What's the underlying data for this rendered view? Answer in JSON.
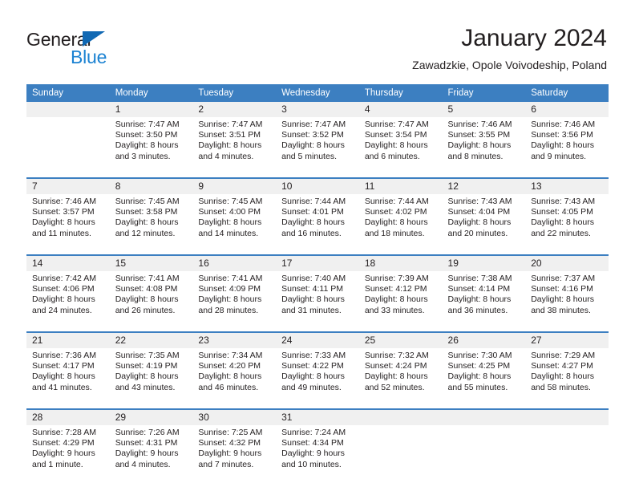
{
  "brand": {
    "name_part1": "General",
    "name_part2": "Blue",
    "triangle_color": "#1068b3",
    "blue_color": "#1b82d2"
  },
  "header": {
    "title": "January 2024",
    "subtitle": "Zawadzkie, Opole Voivodeship, Poland"
  },
  "theme": {
    "header_blue": "#3c7fc1",
    "daynum_bg": "#f0f0f0",
    "text_color": "#231f20"
  },
  "calendar": {
    "weekday_headers": [
      "Sunday",
      "Monday",
      "Tuesday",
      "Wednesday",
      "Thursday",
      "Friday",
      "Saturday"
    ],
    "weeks": [
      [
        {
          "day": "",
          "lines": []
        },
        {
          "day": "1",
          "lines": [
            "Sunrise: 7:47 AM",
            "Sunset: 3:50 PM",
            "Daylight: 8 hours",
            "and 3 minutes."
          ]
        },
        {
          "day": "2",
          "lines": [
            "Sunrise: 7:47 AM",
            "Sunset: 3:51 PM",
            "Daylight: 8 hours",
            "and 4 minutes."
          ]
        },
        {
          "day": "3",
          "lines": [
            "Sunrise: 7:47 AM",
            "Sunset: 3:52 PM",
            "Daylight: 8 hours",
            "and 5 minutes."
          ]
        },
        {
          "day": "4",
          "lines": [
            "Sunrise: 7:47 AM",
            "Sunset: 3:54 PM",
            "Daylight: 8 hours",
            "and 6 minutes."
          ]
        },
        {
          "day": "5",
          "lines": [
            "Sunrise: 7:46 AM",
            "Sunset: 3:55 PM",
            "Daylight: 8 hours",
            "and 8 minutes."
          ]
        },
        {
          "day": "6",
          "lines": [
            "Sunrise: 7:46 AM",
            "Sunset: 3:56 PM",
            "Daylight: 8 hours",
            "and 9 minutes."
          ]
        }
      ],
      [
        {
          "day": "7",
          "lines": [
            "Sunrise: 7:46 AM",
            "Sunset: 3:57 PM",
            "Daylight: 8 hours",
            "and 11 minutes."
          ]
        },
        {
          "day": "8",
          "lines": [
            "Sunrise: 7:45 AM",
            "Sunset: 3:58 PM",
            "Daylight: 8 hours",
            "and 12 minutes."
          ]
        },
        {
          "day": "9",
          "lines": [
            "Sunrise: 7:45 AM",
            "Sunset: 4:00 PM",
            "Daylight: 8 hours",
            "and 14 minutes."
          ]
        },
        {
          "day": "10",
          "lines": [
            "Sunrise: 7:44 AM",
            "Sunset: 4:01 PM",
            "Daylight: 8 hours",
            "and 16 minutes."
          ]
        },
        {
          "day": "11",
          "lines": [
            "Sunrise: 7:44 AM",
            "Sunset: 4:02 PM",
            "Daylight: 8 hours",
            "and 18 minutes."
          ]
        },
        {
          "day": "12",
          "lines": [
            "Sunrise: 7:43 AM",
            "Sunset: 4:04 PM",
            "Daylight: 8 hours",
            "and 20 minutes."
          ]
        },
        {
          "day": "13",
          "lines": [
            "Sunrise: 7:43 AM",
            "Sunset: 4:05 PM",
            "Daylight: 8 hours",
            "and 22 minutes."
          ]
        }
      ],
      [
        {
          "day": "14",
          "lines": [
            "Sunrise: 7:42 AM",
            "Sunset: 4:06 PM",
            "Daylight: 8 hours",
            "and 24 minutes."
          ]
        },
        {
          "day": "15",
          "lines": [
            "Sunrise: 7:41 AM",
            "Sunset: 4:08 PM",
            "Daylight: 8 hours",
            "and 26 minutes."
          ]
        },
        {
          "day": "16",
          "lines": [
            "Sunrise: 7:41 AM",
            "Sunset: 4:09 PM",
            "Daylight: 8 hours",
            "and 28 minutes."
          ]
        },
        {
          "day": "17",
          "lines": [
            "Sunrise: 7:40 AM",
            "Sunset: 4:11 PM",
            "Daylight: 8 hours",
            "and 31 minutes."
          ]
        },
        {
          "day": "18",
          "lines": [
            "Sunrise: 7:39 AM",
            "Sunset: 4:12 PM",
            "Daylight: 8 hours",
            "and 33 minutes."
          ]
        },
        {
          "day": "19",
          "lines": [
            "Sunrise: 7:38 AM",
            "Sunset: 4:14 PM",
            "Daylight: 8 hours",
            "and 36 minutes."
          ]
        },
        {
          "day": "20",
          "lines": [
            "Sunrise: 7:37 AM",
            "Sunset: 4:16 PM",
            "Daylight: 8 hours",
            "and 38 minutes."
          ]
        }
      ],
      [
        {
          "day": "21",
          "lines": [
            "Sunrise: 7:36 AM",
            "Sunset: 4:17 PM",
            "Daylight: 8 hours",
            "and 41 minutes."
          ]
        },
        {
          "day": "22",
          "lines": [
            "Sunrise: 7:35 AM",
            "Sunset: 4:19 PM",
            "Daylight: 8 hours",
            "and 43 minutes."
          ]
        },
        {
          "day": "23",
          "lines": [
            "Sunrise: 7:34 AM",
            "Sunset: 4:20 PM",
            "Daylight: 8 hours",
            "and 46 minutes."
          ]
        },
        {
          "day": "24",
          "lines": [
            "Sunrise: 7:33 AM",
            "Sunset: 4:22 PM",
            "Daylight: 8 hours",
            "and 49 minutes."
          ]
        },
        {
          "day": "25",
          "lines": [
            "Sunrise: 7:32 AM",
            "Sunset: 4:24 PM",
            "Daylight: 8 hours",
            "and 52 minutes."
          ]
        },
        {
          "day": "26",
          "lines": [
            "Sunrise: 7:30 AM",
            "Sunset: 4:25 PM",
            "Daylight: 8 hours",
            "and 55 minutes."
          ]
        },
        {
          "day": "27",
          "lines": [
            "Sunrise: 7:29 AM",
            "Sunset: 4:27 PM",
            "Daylight: 8 hours",
            "and 58 minutes."
          ]
        }
      ],
      [
        {
          "day": "28",
          "lines": [
            "Sunrise: 7:28 AM",
            "Sunset: 4:29 PM",
            "Daylight: 9 hours",
            "and 1 minute."
          ]
        },
        {
          "day": "29",
          "lines": [
            "Sunrise: 7:26 AM",
            "Sunset: 4:31 PM",
            "Daylight: 9 hours",
            "and 4 minutes."
          ]
        },
        {
          "day": "30",
          "lines": [
            "Sunrise: 7:25 AM",
            "Sunset: 4:32 PM",
            "Daylight: 9 hours",
            "and 7 minutes."
          ]
        },
        {
          "day": "31",
          "lines": [
            "Sunrise: 7:24 AM",
            "Sunset: 4:34 PM",
            "Daylight: 9 hours",
            "and 10 minutes."
          ]
        },
        {
          "day": "",
          "lines": []
        },
        {
          "day": "",
          "lines": []
        },
        {
          "day": "",
          "lines": []
        }
      ]
    ]
  }
}
